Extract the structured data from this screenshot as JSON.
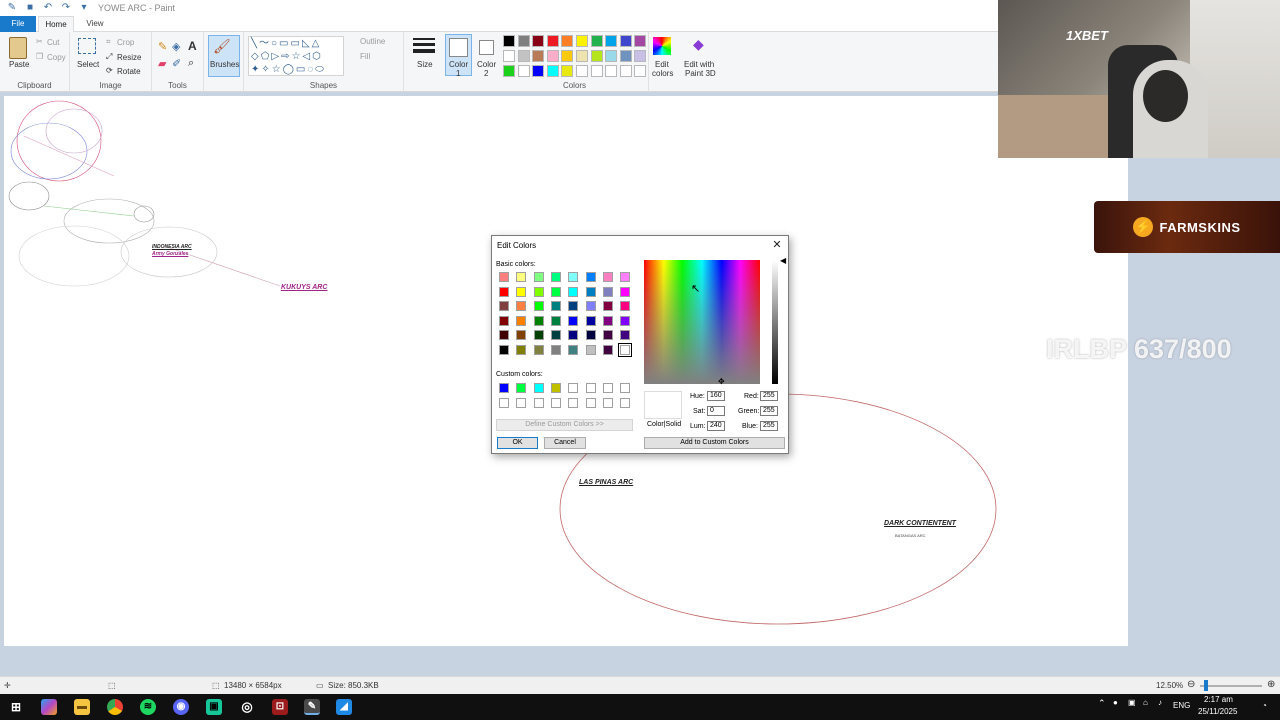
{
  "window": {
    "title": "YOWE ARC - Paint"
  },
  "menu": {
    "file": "File",
    "home": "Home",
    "view": "View"
  },
  "ribbon": {
    "clipboard": {
      "paste": "Paste",
      "cut": "Cut",
      "copy": "Copy",
      "label": "Clipboard"
    },
    "image": {
      "select": "Select",
      "crop": "Crop",
      "resize": "Resize",
      "rotate": "Rotate",
      "label": "Image"
    },
    "tools": {
      "label": "Tools"
    },
    "brushes": {
      "label": "Brushes"
    },
    "shapes": {
      "outline": "Outline",
      "fill": "Fill",
      "label": "Shapes"
    },
    "size": {
      "label": "Size"
    },
    "color1": {
      "label_line1": "Color",
      "label_line2": "1"
    },
    "color2": {
      "label_line1": "Color",
      "label_line2": "2"
    },
    "colors": {
      "label": "Colors",
      "row1": [
        "#000000",
        "#7f7f7f",
        "#880015",
        "#ed1c24",
        "#ff7f27",
        "#fff200",
        "#22b14c",
        "#00a2e8",
        "#3f48cc",
        "#a349a4"
      ],
      "row2": [
        "#ffffff",
        "#c3c3c3",
        "#b97a57",
        "#ffaec9",
        "#ffc90e",
        "#efe4b0",
        "#b5e61d",
        "#99d9ea",
        "#7092be",
        "#c8bfe7"
      ],
      "row3": [
        "#1bd11b",
        "#ffffff",
        "#0000ff",
        "#00ffff",
        "#e8e812",
        "#ffffff",
        "#ffffff",
        "#ffffff",
        "#ffffff",
        "#ffffff"
      ]
    },
    "edit_colors": {
      "line1": "Edit",
      "line2": "colors"
    },
    "paint3d": {
      "line1": "Edit with",
      "line2": "Paint 3D"
    }
  },
  "canvas": {
    "labels": {
      "kukuys": "KUKUYS ARC",
      "indonesia": "INDONESIA ARC",
      "army": "Army Gonzales",
      "las_pinas": "LAS PINAS ARC",
      "dark_continent": "DARK CONTIENTENT",
      "batangas": "BATANGAS ARC"
    }
  },
  "overlay": {
    "sponsor": "1XBET",
    "farmskins": "FARMSKINS",
    "goal": "IRLBP 637/800"
  },
  "dialog": {
    "title": "Edit Colors",
    "basic_label": "Basic colors:",
    "custom_label": "Custom colors:",
    "define_btn": "Define Custom Colors >>",
    "ok": "OK",
    "cancel": "Cancel",
    "color_solid": "Color|Solid",
    "add_custom": "Add to Custom Colors",
    "hue_label": "Hue:",
    "hue": "160",
    "sat_label": "Sat:",
    "sat": "0",
    "lum_label": "Lum:",
    "lum": "240",
    "red_label": "Red:",
    "red": "255",
    "green_label": "Green:",
    "green": "255",
    "blue_label": "Blue:",
    "blue": "255",
    "basic_colors": [
      [
        "#ff8080",
        "#ffff80",
        "#80ff80",
        "#00ff80",
        "#80ffff",
        "#0080ff",
        "#ff80c0",
        "#ff80ff"
      ],
      [
        "#ff0000",
        "#ffff00",
        "#80ff00",
        "#00ff40",
        "#00ffff",
        "#0080c0",
        "#8080c0",
        "#ff00ff"
      ],
      [
        "#804040",
        "#ff8040",
        "#00ff00",
        "#008080",
        "#004080",
        "#8080ff",
        "#800040",
        "#ff0080"
      ],
      [
        "#800000",
        "#ff8000",
        "#008000",
        "#008040",
        "#0000ff",
        "#0000a0",
        "#800080",
        "#8000ff"
      ],
      [
        "#400000",
        "#804000",
        "#004000",
        "#004040",
        "#000080",
        "#000040",
        "#400040",
        "#400080"
      ],
      [
        "#000000",
        "#808000",
        "#808040",
        "#808080",
        "#408080",
        "#c0c0c0",
        "#400040",
        "#ffffff"
      ]
    ],
    "custom_colors": [
      [
        "#0000ff",
        "#00ff40",
        "#00ffff",
        "#c0c000",
        "#ffffff",
        "#ffffff",
        "#ffffff",
        "#ffffff"
      ],
      [
        "#ffffff",
        "#ffffff",
        "#ffffff",
        "#ffffff",
        "#ffffff",
        "#ffffff",
        "#ffffff",
        "#ffffff"
      ]
    ]
  },
  "status": {
    "dimensions": "13480 × 6584px",
    "size": "Size: 850.3KB",
    "zoom": "12.50%"
  },
  "taskbar": {
    "lang": "ENG",
    "time": "2:17 am",
    "date": "25/11/2025"
  }
}
